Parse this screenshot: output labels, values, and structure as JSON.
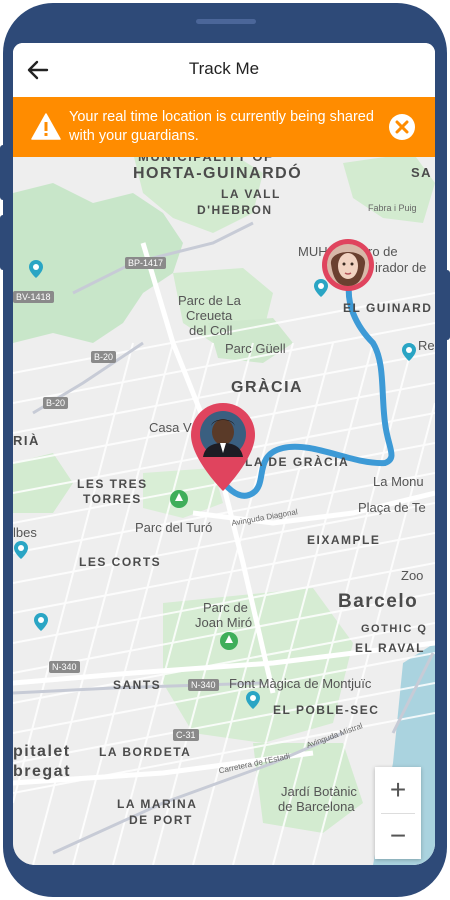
{
  "header": {
    "title": "Track Me"
  },
  "banner": {
    "message": "Your real time location is currently being shared with your guardians."
  },
  "map": {
    "areas": {
      "municipality": "MUNICIPALITY OF",
      "horta": "HORTA-GUINARDÓ",
      "la_vall": "LA VALL",
      "dhebron": "D'HEBRON",
      "gracia": "GRÀCIA",
      "les_tres": "LES TRES",
      "torres": "TORRES",
      "les_corts": "LES CORTS",
      "eixample": "EIXAMPLE",
      "el_raval": "EL RAVAL",
      "gothic": "GOTHIC Q",
      "el_poble_sec": "EL POBLE-SEC",
      "la_bordeta": "LA BORDETA",
      "la_marina": "LA MARINA",
      "de_port": "DE PORT",
      "el_guinard": "EL GUINARD",
      "la_de_gracia": "LA DE GRÀCIA",
      "sa": "SA",
      "ria": "RIÀ"
    },
    "places": {
      "parc_crueta_1": "Parc de La",
      "parc_crueta_2": "Creueta",
      "parc_crueta_3": "del Coll",
      "parc_guell": "Parc Güell",
      "casa_v": "Casa V",
      "parc_turo": "Parc del Turó",
      "placa_te": "Plaça de Te",
      "la_monu": "La Monu",
      "parc_miro_1": "Parc de",
      "parc_miro_2": "Joan Miró",
      "font_magica": "Font Màgica de Montjuïc",
      "jardi_1": "Jardí Botànic",
      "jardi_2": "de Barcelona",
      "muh": "MUH",
      "ro_de": "ro de",
      "irador_de": "irador de",
      "zoo": "Zoo",
      "re": "Re",
      "lbes": "lbes",
      "pitalet": "pitalet",
      "bregat": "bregat",
      "barcelona": "Barcelo",
      "diagonal": "Avinguda Diagonal",
      "mistral": "Avinguda Mistral",
      "estadi": "Carretera de l'Estadi",
      "fabra": "Fabra i Puig"
    },
    "roads": [
      "BP-1417",
      "BV-1418",
      "B-20",
      "B-20",
      "N-340",
      "N-340",
      "C-31"
    ],
    "santes": "SANTS",
    "people": [
      {
        "name": "guardian-woman",
        "color": "#e0445e"
      },
      {
        "name": "user-man",
        "color": "#e0445e"
      }
    ],
    "route_color": "#3d9ad6"
  },
  "zoom": {
    "in": "+",
    "out": "−"
  },
  "colors": {
    "banner": "#ff8c00",
    "frame": "#2e4a78",
    "park": "#c8e6c9",
    "pin": "#e0445e"
  }
}
